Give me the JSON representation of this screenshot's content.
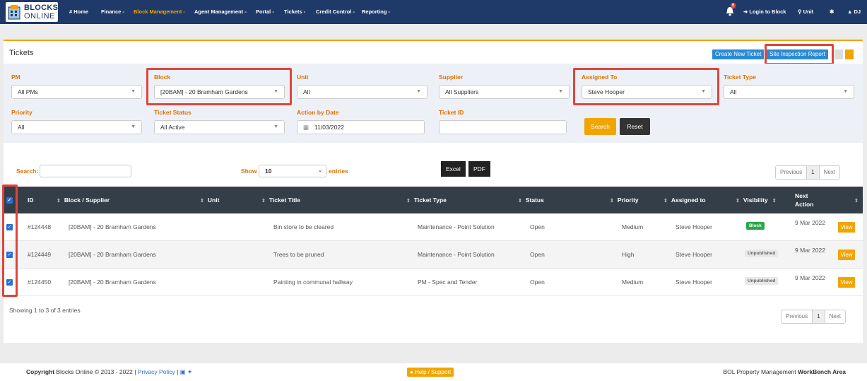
{
  "app": {
    "logo_line1": "BLOCKS",
    "logo_line2": "ONLINE"
  },
  "nav": {
    "items": [
      {
        "label": "# Home"
      },
      {
        "label": "Finance -"
      },
      {
        "label": "Block Management -"
      },
      {
        "label": "Agent Management -"
      },
      {
        "label": "Portal -"
      },
      {
        "label": "Tickets -"
      },
      {
        "label": "Credit Control -"
      },
      {
        "label": "Reporting -"
      }
    ],
    "notification_count": "6",
    "login_to_block": "Login to Block",
    "unit_search": "Unit",
    "user": "DJ"
  },
  "page": {
    "title": "Tickets",
    "create_button": "Create New Ticket",
    "site_inspection_button": "Site Inspection Report"
  },
  "filters": {
    "pm": {
      "label": "PM",
      "value": "All PMs"
    },
    "block": {
      "label": "Block",
      "value": "[20BAM] - 20 Bramham Gardens"
    },
    "unit": {
      "label": "Unit",
      "value": "All"
    },
    "supplier": {
      "label": "Supplier",
      "value": "All Suppliers"
    },
    "assigned_to": {
      "label": "Assigned To",
      "value": "Steve Hooper"
    },
    "ticket_type": {
      "label": "Ticket Type",
      "value": "All"
    },
    "priority": {
      "label": "Priority",
      "value": "All"
    },
    "ticket_status": {
      "label": "Ticket Status",
      "value": "All Active"
    },
    "action_by_date": {
      "label": "Action by Date",
      "value": "11/03/2022"
    },
    "ticket_id": {
      "label": "Ticket ID",
      "value": ""
    },
    "search_button": "Search",
    "reset_button": "Reset"
  },
  "table_controls": {
    "search_label": "Search:",
    "show_label": "Show",
    "length_value": "10",
    "entries_label": "entries",
    "export_excel": "Excel",
    "export_pdf": "PDF",
    "prev": "Previous",
    "page": "1",
    "next": "Next"
  },
  "table": {
    "headers": {
      "id": "ID",
      "block": "Block / Supplier",
      "unit": "Unit",
      "title": "Ticket Title",
      "type": "Ticket Type",
      "status": "Status",
      "priority": "Priority",
      "assigned": "Assigned to",
      "visibility": "Visibility",
      "next_action_1": "Next",
      "next_action_2": "Action"
    },
    "rows": [
      {
        "id": "#124448",
        "block": "[20BAM] - 20 Bramham Gardens",
        "unit": "",
        "title": "Bin store to be cleared",
        "type": "Maintenance - Point Solution",
        "status": "Open",
        "priority": "Medium",
        "assigned": "Steve Hooper",
        "visibility": "Block",
        "next_action": "9 Mar 2022",
        "view": "View"
      },
      {
        "id": "#124449",
        "block": "[20BAM] - 20 Bramham Gardens",
        "unit": "",
        "title": "Trees to be pruned",
        "type": "Maintenance - Point Solution",
        "status": "Open",
        "priority": "High",
        "assigned": "Steve Hooper",
        "visibility": "Unpublished",
        "next_action": "9 Mar 2022",
        "view": "View"
      },
      {
        "id": "#124450",
        "block": "[20BAM] - 20 Bramham Gardens",
        "unit": "",
        "title": "Painting in communal hallway",
        "type": "PM - Spec and Tender",
        "status": "Open",
        "priority": "Medium",
        "assigned": "Steve Hooper",
        "visibility": "Unpublished",
        "next_action": "9 Mar 2022",
        "view": "View"
      }
    ],
    "info": "Showing 1 to 3 of 3 entries"
  },
  "footer": {
    "copyright_bold": "Copyright",
    "copyright_text": "Blocks Online © 2013 - 2022 |",
    "privacy": "Privacy Policy",
    "separator": "|",
    "help": "Help / Support",
    "right_text": "BOL Property Management",
    "right_bold": "WorkBench Area"
  },
  "colors": {
    "nav_bg": "#1f3a68",
    "accent_orange": "#f0a500",
    "primary_blue": "#2a8ad4",
    "highlight_red": "#e0443a",
    "table_header": "#333e48"
  }
}
